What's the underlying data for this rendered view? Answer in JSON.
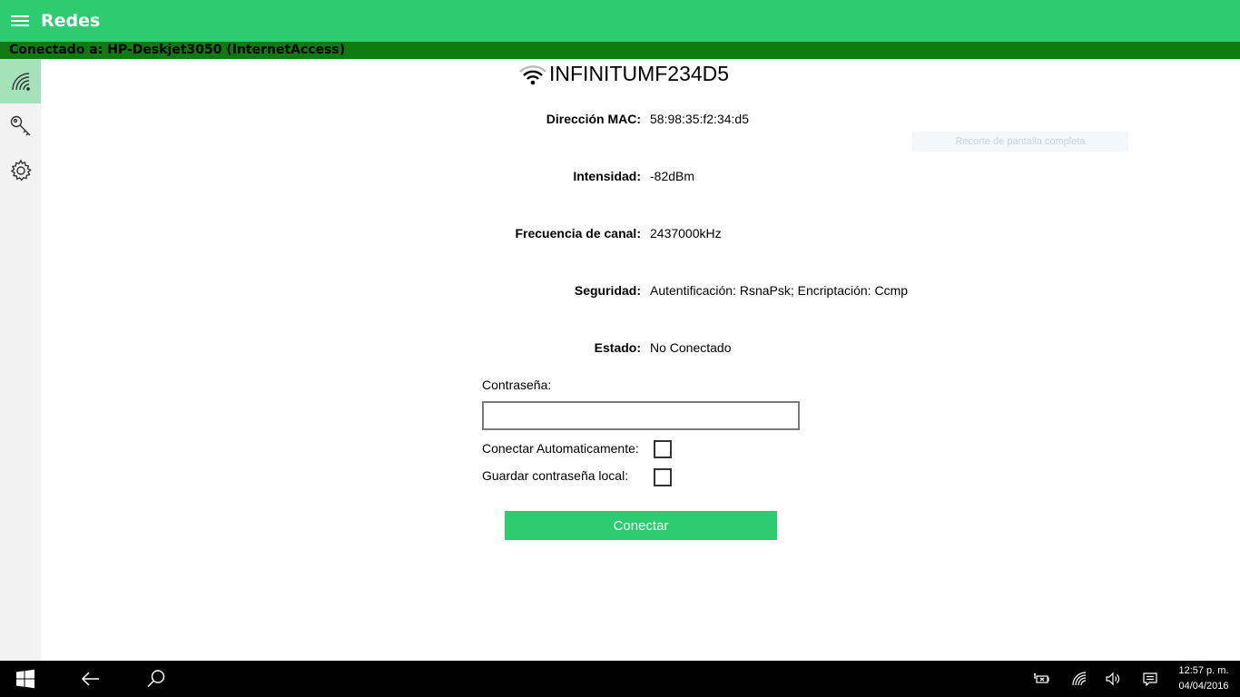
{
  "app": {
    "title": "Redes"
  },
  "status": {
    "text": "Conectado a: HP-Deskjet3050 (InternetAccess)"
  },
  "rail": {
    "items": [
      {
        "name": "networks",
        "icon": "wifi-icon",
        "active": true
      },
      {
        "name": "keys",
        "icon": "key-icon",
        "active": false
      },
      {
        "name": "settings",
        "icon": "gear-icon",
        "active": false
      }
    ]
  },
  "network": {
    "ssid": "INFINITUMF234D5",
    "fields": [
      {
        "label": "Dirección MAC:",
        "value": "58:98:35:f2:34:d5"
      },
      {
        "label": "Intensidad:",
        "value": "-82dBm"
      },
      {
        "label": "Frecuencia de canal:",
        "value": "2437000kHz"
      },
      {
        "label": "Seguridad:",
        "value": "Autentificación: RsnaPsk; Encriptación: Ccmp"
      },
      {
        "label": "Estado:",
        "value": "No Conectado"
      }
    ]
  },
  "overlay": {
    "text": "Recorte de pantalla completa"
  },
  "form": {
    "password_label": "Contraseña:",
    "password_value": "",
    "auto_connect_label": "Conectar Automaticamente:",
    "save_password_label": "Guardar contraseña local:",
    "connect_label": "Conectar"
  },
  "taskbar": {
    "time": "12:57 p. m.",
    "date": "04/04/2016"
  },
  "colors": {
    "accent": "#2ecc71",
    "status_bar": "#0f7a0f",
    "rail_active": "#a5e2b9"
  }
}
